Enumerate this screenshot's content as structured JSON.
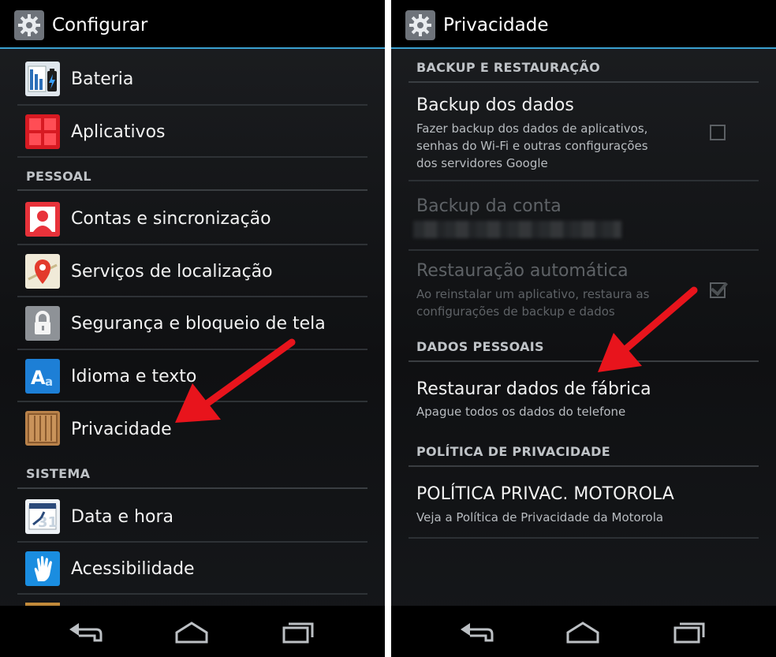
{
  "left_screen": {
    "title": "Configurar",
    "items_top": [
      {
        "label": "Bateria",
        "icon": "battery-icon"
      },
      {
        "label": "Aplicativos",
        "icon": "apps-grid-icon"
      }
    ],
    "section_personal": "PESSOAL",
    "items_personal": [
      {
        "label": "Contas e sincronização",
        "icon": "accounts-sync-icon"
      },
      {
        "label": "Serviços de localização",
        "icon": "location-pin-icon"
      },
      {
        "label": "Segurança e bloqueio de tela",
        "icon": "lock-icon"
      },
      {
        "label": "Idioma e texto",
        "icon": "language-icon"
      },
      {
        "label": "Privacidade",
        "icon": "privacy-crate-icon"
      }
    ],
    "section_system": "SISTEMA",
    "items_system": [
      {
        "label": "Data e hora",
        "icon": "calendar-clock-icon"
      },
      {
        "label": "Acessibilidade",
        "icon": "hand-icon"
      }
    ]
  },
  "right_screen": {
    "title": "Privacidade",
    "section_backup": "BACKUP E RESTAURAÇÃO",
    "backup_data": {
      "title": "Backup dos dados",
      "subtitle": "Fazer backup dos dados de aplicativos,\nsenhas do Wi-Fi e outras configurações\ndos servidores Google",
      "checked": false
    },
    "backup_account": {
      "title": "Backup da conta"
    },
    "auto_restore": {
      "title": "Restauração automática",
      "subtitle": "Ao reinstalar um aplicativo, restaura as\nconfigurações de backup e dados",
      "checked": true
    },
    "section_personal_data": "DADOS PESSOAIS",
    "factory_reset": {
      "title": "Restaurar dados de fábrica",
      "subtitle": "Apague todos os dados do telefone"
    },
    "section_privacy_policy": "POLÍTICA DE PRIVACIDADE",
    "motorola_policy": {
      "title": "POLÍTICA PRIVAC. MOTOROLA",
      "subtitle": "Veja a Política de Privacidade da Motorola"
    }
  },
  "colors": {
    "accent": "#3aa0d0",
    "arrow": "#e8141c",
    "background": "#111315"
  }
}
